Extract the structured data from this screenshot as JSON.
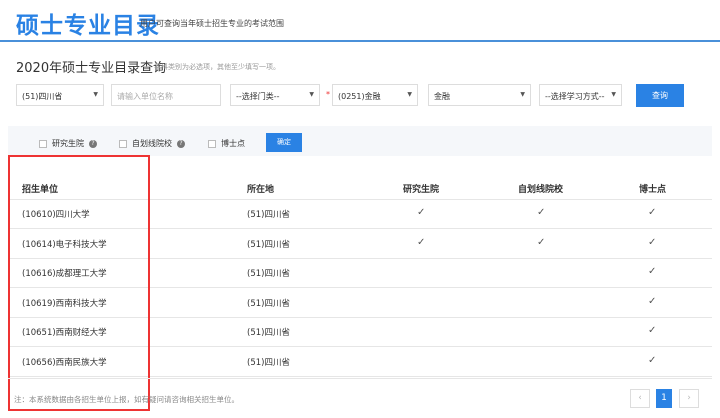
{
  "header": {
    "title": "硕士专业目录",
    "subtitle": "用户可查询当年硕士招生专业的考试范围"
  },
  "page": {
    "title": "2020年硕士专业目录查询",
    "hint": "学科类别为必选项，其他至少填写一项。"
  },
  "filters": {
    "province": "(51)四川省",
    "unit_placeholder": "请输入单位名称",
    "category": "--选择门类--",
    "discipline": "(0251)金融",
    "major": "金融",
    "study_mode": "--选择学习方式--",
    "search_label": "查询"
  },
  "checks": {
    "items": [
      "研究生院",
      "自划线院校",
      "博士点"
    ],
    "confirm_label": "确定"
  },
  "table": {
    "headers": [
      "招生单位",
      "所在地",
      "研究生院",
      "自划线院校",
      "博士点"
    ],
    "rows": [
      {
        "unit": "(10610)四川大学",
        "loc": "(51)四川省",
        "grad": true,
        "self": true,
        "phd": true
      },
      {
        "unit": "(10614)电子科技大学",
        "loc": "(51)四川省",
        "grad": true,
        "self": true,
        "phd": true
      },
      {
        "unit": "(10616)成都理工大学",
        "loc": "(51)四川省",
        "grad": false,
        "self": false,
        "phd": true
      },
      {
        "unit": "(10619)西南科技大学",
        "loc": "(51)四川省",
        "grad": false,
        "self": false,
        "phd": true
      },
      {
        "unit": "(10651)西南财经大学",
        "loc": "(51)四川省",
        "grad": false,
        "self": false,
        "phd": true
      },
      {
        "unit": "(10656)西南民族大学",
        "loc": "(51)四川省",
        "grad": false,
        "self": false,
        "phd": true
      }
    ]
  },
  "footer": {
    "note": "注：本系统数据由各招生单位上报，如有疑问请咨询相关招生单位。",
    "prev": "‹",
    "page": "1",
    "next": "›"
  },
  "check_mark": "✓"
}
